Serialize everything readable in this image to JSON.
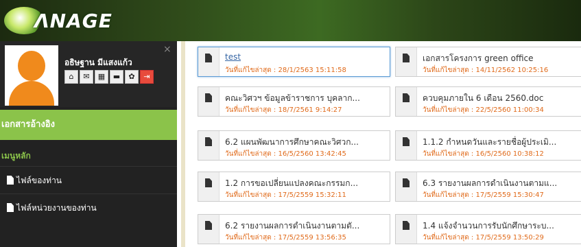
{
  "header": {
    "logo_text": "ɅNAGE"
  },
  "profile": {
    "name": "อธิษฐาน มีแสงแก้ว",
    "close": "×",
    "icons": [
      {
        "name": "home-icon",
        "glyph": "⌂"
      },
      {
        "name": "mail-icon",
        "glyph": "✉"
      },
      {
        "name": "calendar-icon",
        "glyph": "▦"
      },
      {
        "name": "comment-icon",
        "glyph": "▬"
      },
      {
        "name": "gear-icon",
        "glyph": "✿"
      },
      {
        "name": "logout-icon",
        "glyph": "⇥"
      }
    ]
  },
  "sidebar": {
    "active": "เอกสารอ้างอิง",
    "section": "เมนูหลัก",
    "items": [
      "ไฟล์ของท่าน",
      "ไฟล์หน่วยงานของท่าน"
    ]
  },
  "documents": [
    {
      "title": "test",
      "date": "วันที่แก้ไขล่าสุด : 28/1/2563 15:11:58"
    },
    {
      "title": "เอกสารโครงการ green office",
      "date": "วันที่แก้ไขล่าสุด : 14/11/2562 10:25:16"
    },
    {
      "title": "คณะวิศวฯ ข้อมูลข้าราชการ บุคลาก...",
      "date": "วันที่แก้ไขล่าสุด : 18/7/2561 9:14:27"
    },
    {
      "title": "ควบคุมภายใน 6 เดือน 2560.doc",
      "date": "วันที่แก้ไขล่าสุด : 22/5/2560 11:00:34"
    },
    {
      "title": "6.2 แผนพัฒนาการศึกษาคณะวิศวก...",
      "date": "วันที่แก้ไขล่าสุด : 16/5/2560 13:42:45"
    },
    {
      "title": "1.1.2 กำหนดวันและรายชื่อผู้ประเมิ...",
      "date": "วันที่แก้ไขล่าสุด : 16/5/2560 10:38:12"
    },
    {
      "title": "1.2 การขอเปลี่ยนแปลงคณะกรรมก...",
      "date": "วันที่แก้ไขล่าสุด : 17/5/2559 15:32:11"
    },
    {
      "title": "6.3 รายงานผลการดำเนินงานตามแ...",
      "date": "วันที่แก้ไขล่าสุด : 17/5/2559 15:30:47"
    },
    {
      "title": "6.2 รายงานผลการดำเนินงานตามตั...",
      "date": "วันที่แก้ไขล่าสุด : 17/5/2559 13:56:35"
    },
    {
      "title": "1.4 แจ้งจำนวนการรับนักศึกษาระบ...",
      "date": "วันที่แก้ไขล่าสุด : 17/5/2559 13:50:29"
    }
  ],
  "colors": {
    "accent": "#8bc34a",
    "date": "#e06a1a",
    "link": "#3465a4",
    "avatar": "#f08a1c"
  }
}
